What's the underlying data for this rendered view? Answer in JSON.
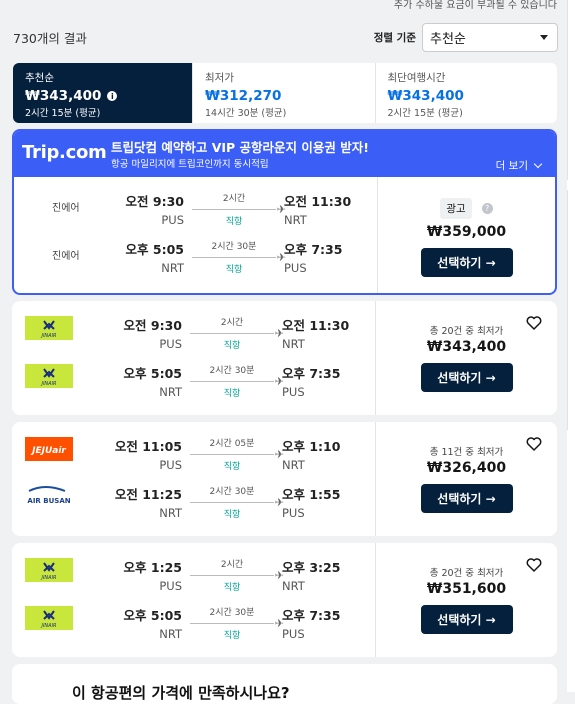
{
  "top_note": "추가 수하물 요금이 부과될 수 있습니다",
  "header": {
    "results": "730개의 결과",
    "sort_label": "정렬 기준",
    "sort_value": "추천순"
  },
  "tabs": [
    {
      "label": "추천순",
      "price": "₩343,400",
      "duration": "2시간 15분 (평균)",
      "active": true
    },
    {
      "label": "최저가",
      "price": "₩312,270",
      "duration": "14시간 30분 (평균)",
      "active": false
    },
    {
      "label": "최단여행시간",
      "price": "₩343,400",
      "duration": "2시간 15분 (평균)",
      "active": false
    }
  ],
  "ad": {
    "logo": "Trip.com",
    "headline": "트립닷컴 예약하고 VIP 공항라운지 이용권 받자!",
    "subline": "항공 마일리지에 트립코인까지 동시적립",
    "more": "더 보기",
    "ad_label": "광고",
    "price": "₩359,000",
    "select": "선택하기 →",
    "legs": [
      {
        "airline": "진에어",
        "dep_time": "오전 9:30",
        "dep_code": "PUS",
        "duration": "2시간",
        "stops": "직항",
        "arr_time": "오전 11:30",
        "arr_code": "NRT"
      },
      {
        "airline": "진에어",
        "dep_time": "오후 5:05",
        "dep_code": "NRT",
        "duration": "2시간 30분",
        "stops": "직항",
        "arr_time": "오후 7:35",
        "arr_code": "PUS"
      }
    ]
  },
  "cards": [
    {
      "deals": "총 20건 중 최저가",
      "price": "₩343,400",
      "select": "선택하기 →",
      "legs": [
        {
          "airline_logo": "jinair",
          "logo_text": "JINAIR",
          "dep_time": "오전 9:30",
          "dep_code": "PUS",
          "duration": "2시간",
          "stops": "직항",
          "arr_time": "오전 11:30",
          "arr_code": "NRT"
        },
        {
          "airline_logo": "jinair",
          "logo_text": "JINAIR",
          "dep_time": "오후 5:05",
          "dep_code": "NRT",
          "duration": "2시간 30분",
          "stops": "직항",
          "arr_time": "오후 7:35",
          "arr_code": "PUS"
        }
      ]
    },
    {
      "deals": "총 11건 중 최저가",
      "price": "₩326,400",
      "select": "선택하기 →",
      "legs": [
        {
          "airline_logo": "jejuair",
          "logo_text": "JEJUair",
          "dep_time": "오전 11:05",
          "dep_code": "PUS",
          "duration": "2시간 05분",
          "stops": "직항",
          "arr_time": "오후 1:10",
          "arr_code": "NRT"
        },
        {
          "airline_logo": "airbusan",
          "logo_text": "AIR BUSAN",
          "dep_time": "오전 11:25",
          "dep_code": "NRT",
          "duration": "2시간 30분",
          "stops": "직항",
          "arr_time": "오후 1:55",
          "arr_code": "PUS"
        }
      ]
    },
    {
      "deals": "총 20건 중 최저가",
      "price": "₩351,600",
      "select": "선택하기 →",
      "legs": [
        {
          "airline_logo": "jinair",
          "logo_text": "JINAIR",
          "dep_time": "오후 1:25",
          "dep_code": "PUS",
          "duration": "2시간",
          "stops": "직항",
          "arr_time": "오후 3:25",
          "arr_code": "NRT"
        },
        {
          "airline_logo": "jinair",
          "logo_text": "JINAIR",
          "dep_time": "오후 5:05",
          "dep_code": "NRT",
          "duration": "2시간 30분",
          "stops": "직항",
          "arr_time": "오후 7:35",
          "arr_code": "PUS"
        }
      ]
    }
  ],
  "bottom_card": {
    "text": "이 항공편의 가격에 만족하시나요?"
  },
  "colors": {
    "brand_dark": "#05203c",
    "accent_blue": "#0770e3",
    "trip_blue": "#3b5ef7",
    "direct_green": "#00a698"
  }
}
